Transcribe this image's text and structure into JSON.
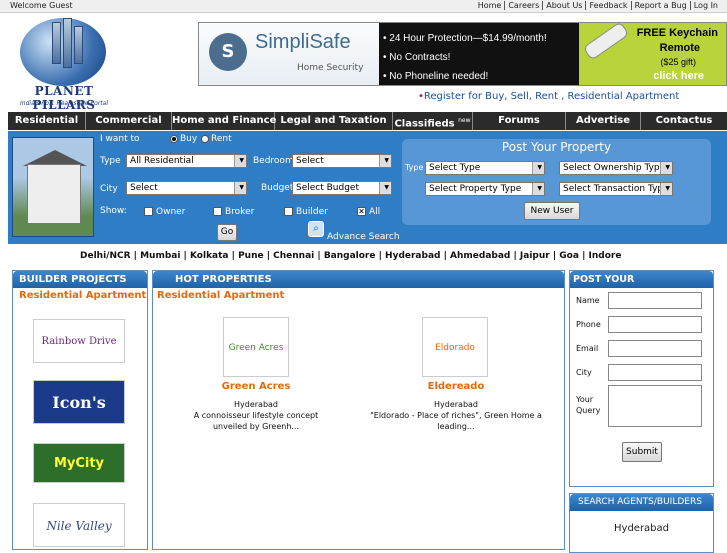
{
  "topbar": {
    "welcome": "Welcome Guest",
    "links": [
      "Home",
      "Careers",
      "About Us",
      "Feedback",
      "Report a Bug",
      "Log In"
    ]
  },
  "logo": {
    "title": "PLANET PILLARS",
    "tagline": "India's no.1 Realestate Portal"
  },
  "ad": {
    "brand": "SimpliSafe",
    "brand_sub": "Home Security",
    "lines": [
      "• 24 Hour Protection—$14.99/month!",
      "• No Contracts!",
      "• No Phoneline needed!"
    ],
    "r1": "FREE Keychain",
    "r2": "Remote",
    "r3": "($25 gift)",
    "r4": "click here"
  },
  "register": {
    "bullet": "•",
    "text": "Register for Buy, Sell, Rent , Residential Apartment"
  },
  "nav": [
    {
      "label": "Residential",
      "w": 78
    },
    {
      "label": "Commercial",
      "w": 86
    },
    {
      "label": "Home and Finance",
      "w": 103
    },
    {
      "label": "Legal and Taxation",
      "w": 118
    },
    {
      "label": "Classifieds",
      "sup": "new",
      "w": 80
    },
    {
      "label": "Forums",
      "w": 93
    },
    {
      "label": "Advertise",
      "w": 75
    },
    {
      "label": "Contactus",
      "w": 86
    }
  ],
  "search": {
    "i_want_to": "I want to",
    "buy": "Buy",
    "rent": "Rent",
    "type": "Type",
    "type_val": "All Residential",
    "bedroom": "Bedroom",
    "bedroom_val": "Select",
    "city": "City",
    "city_val": "Select",
    "budget": "Budget",
    "budget_val": "Select Budget",
    "show": "Show:",
    "owner": "Owner",
    "broker": "Broker",
    "builder": "Builder",
    "all": "All",
    "go": "Go",
    "advance": "Advance Search"
  },
  "post_property": {
    "title": "Post Your Property",
    "type": "Type",
    "select_type": "Select Type",
    "ownership": "Select Ownership Type",
    "property_type": "Select Property Type",
    "transaction": "Select Transaction Type",
    "new_user": "New User"
  },
  "cities": [
    "Delhi/NCR",
    "Mumbai",
    "Kolkata",
    "Pune",
    "Chennai",
    "Bangalore",
    "Hyderabad",
    "Ahmedabad",
    "Jaipur",
    "Goa",
    "Indore"
  ],
  "builder_projects": {
    "title": "BUILDER PROJECTS",
    "subtitle": "Residential Apartment",
    "logos": [
      "Rainbow Drive",
      "Icon's",
      "MyCity",
      "Nile Valley"
    ]
  },
  "hot_properties": {
    "title": "HOT PROPERTIES",
    "subtitle": "Residential Apartment",
    "items": [
      {
        "logo": "Green Acres",
        "name": "Green Acres",
        "city": "Hyderabad",
        "desc": "A connoisseur lifestyle concept unveiled by Greenh..."
      },
      {
        "logo": "Eldorado",
        "name": "Eldereado",
        "city": "Hyderabad",
        "desc": "\"Eldorado - Place of riches\", Green Home a leading..."
      }
    ]
  },
  "requirements": {
    "title": "POST YOUR REQUIREMENTS",
    "name": "Name",
    "phone": "Phone",
    "email": "Email",
    "city": "City",
    "query": "Your Query",
    "submit": "Submit"
  },
  "agents": {
    "title": "SEARCH AGENTS/BUILDERS",
    "city": "Hyderabad"
  }
}
